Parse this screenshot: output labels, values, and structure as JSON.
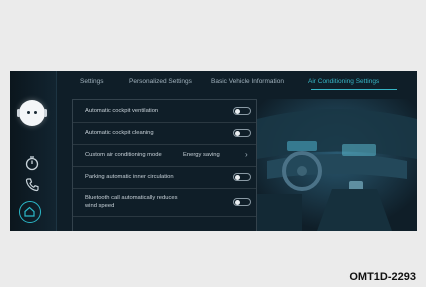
{
  "tabs": [
    {
      "label": "Settings"
    },
    {
      "label": "Personalized Settings"
    },
    {
      "label": "Basic Vehicle Information"
    },
    {
      "label": "Air Conditioning Settings"
    }
  ],
  "settings": [
    {
      "label": "Automatic cockpit ventilation",
      "type": "toggle"
    },
    {
      "label": "Automatic cockpit cleaning",
      "type": "toggle"
    },
    {
      "label": "Custom air conditioning mode",
      "value": "Energy saving",
      "type": "select"
    },
    {
      "label": "Parking automatic inner circulation",
      "type": "toggle"
    },
    {
      "label": "Bluetooth call automatically reduces",
      "label2": "wind speed",
      "type": "toggle"
    }
  ],
  "caption": "OMT1D-2293",
  "colors": {
    "accent": "#37b6c6",
    "background": "#0f1e28",
    "page": "#ebebeb"
  }
}
